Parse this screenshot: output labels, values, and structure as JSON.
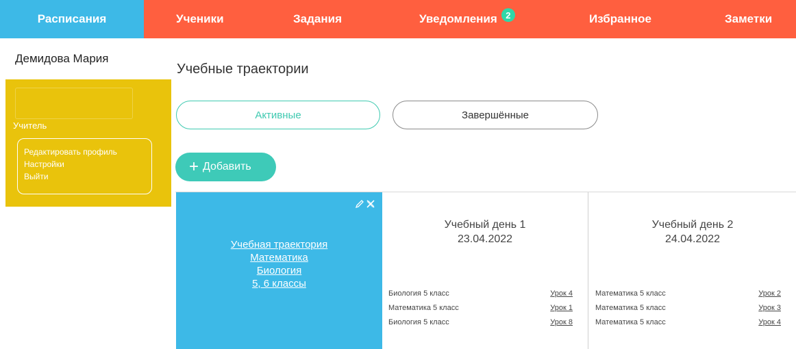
{
  "nav": {
    "schedule": "Расписания",
    "students": "Ученики",
    "tasks": "Задания",
    "notifications": "Уведомления",
    "notifications_count": "2",
    "favorites": "Избранное",
    "notes": "Заметки"
  },
  "user": {
    "name": "Демидова Мария",
    "role": "Учитель",
    "menu": {
      "edit_profile": "Редактировать профиль",
      "settings": "Настройки",
      "logout": "Выйти"
    }
  },
  "page": {
    "title": "Учебные траектории",
    "tabs": {
      "active": "Активные",
      "completed": "Завершённые"
    },
    "add_button": "Добавить"
  },
  "trajectory": {
    "lines": [
      "Учебная траектория",
      "Математика",
      "Биология",
      "5, 6 классы"
    ],
    "icons": [
      "pencil-icon",
      "close-icon"
    ]
  },
  "days": [
    {
      "title": "Учебный день 1",
      "date": "23.04.2022",
      "lessons": [
        {
          "subject": "Биология 5 класс",
          "lesson": "Урок 4"
        },
        {
          "subject": "Математика 5 класс",
          "lesson": "Урок 1"
        },
        {
          "subject": "Биология 5 класс",
          "lesson": "Урок 8"
        }
      ]
    },
    {
      "title": "Учебный день 2",
      "date": "24.04.2022",
      "lessons": [
        {
          "subject": "Математика 5 класс",
          "lesson": "Урок 2"
        },
        {
          "subject": "Математика 5 класс",
          "lesson": "Урок 3"
        },
        {
          "subject": "Математика 5 класс",
          "lesson": "Урок 4"
        }
      ]
    }
  ],
  "colors": {
    "nav_blue": "#3db9e7",
    "nav_orange": "#ff5f3f",
    "sidebar_yellow": "#e9c30c",
    "accent_teal": "#3ecab8",
    "badge_green": "#2fd8a8"
  }
}
